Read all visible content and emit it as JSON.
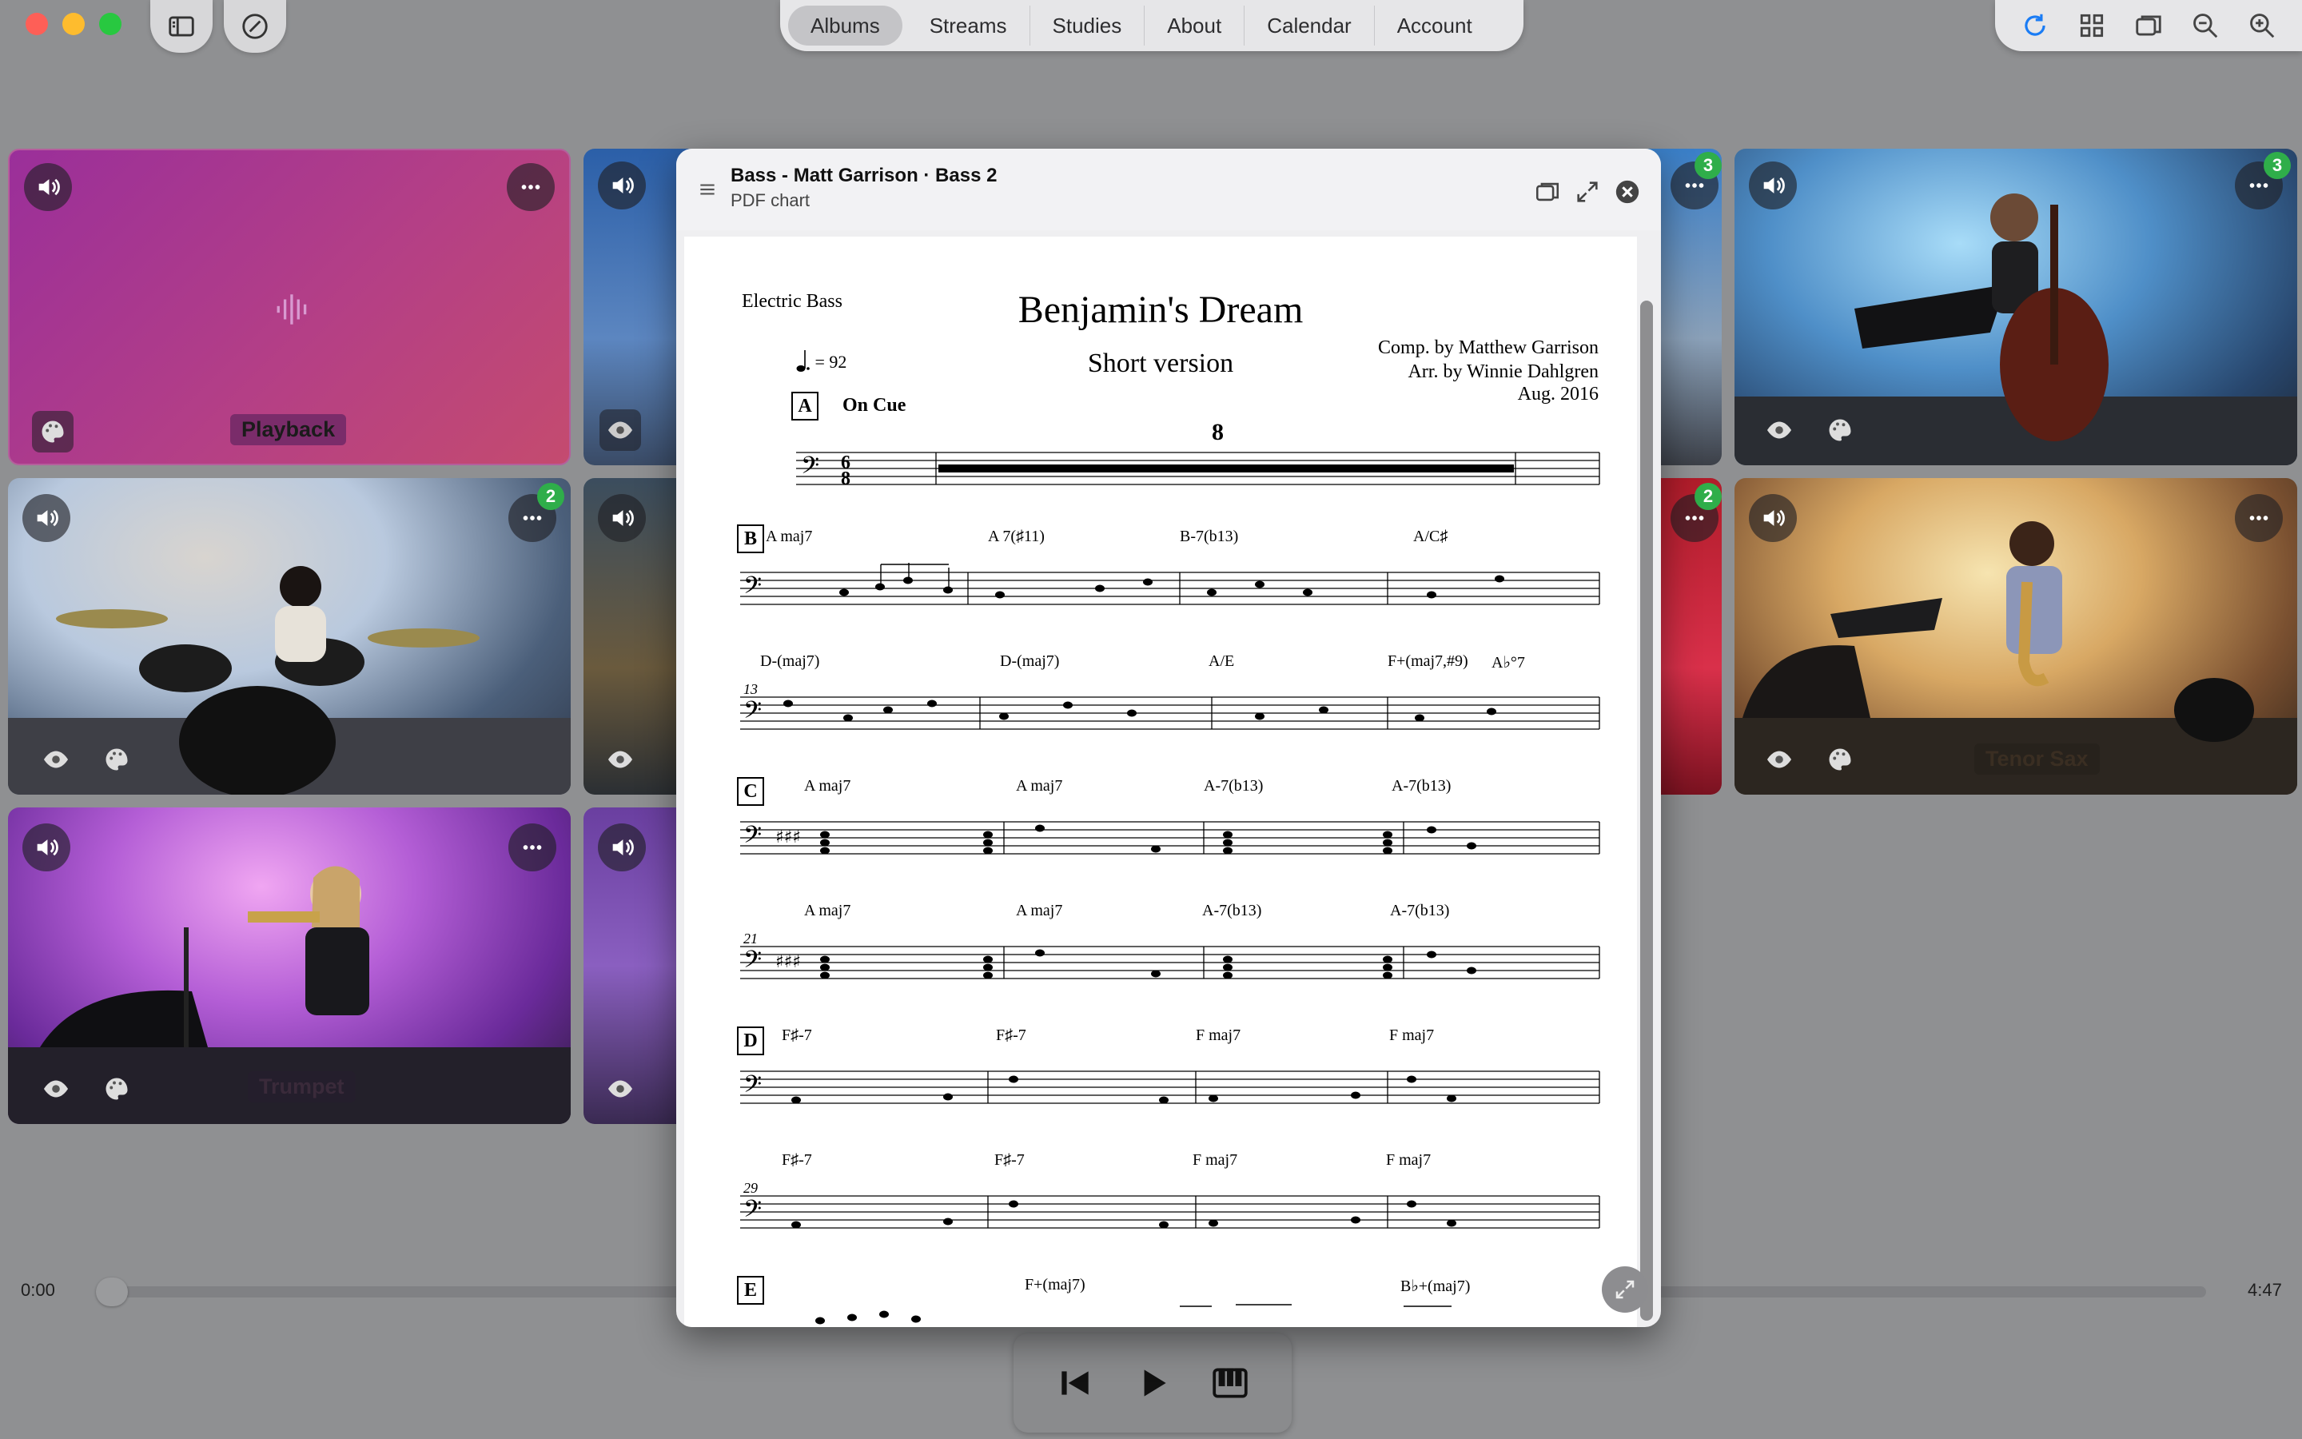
{
  "nav": {
    "tabs": [
      {
        "label": "Albums",
        "active": true
      },
      {
        "label": "Streams",
        "active": false
      },
      {
        "label": "Studies",
        "active": false
      },
      {
        "label": "About",
        "active": false
      },
      {
        "label": "Calendar",
        "active": false
      },
      {
        "label": "Account",
        "active": false
      }
    ]
  },
  "toolbar": {
    "icons": [
      "refresh-icon",
      "grid-icon",
      "windows-icon",
      "zoom-out-icon",
      "zoom-in-icon"
    ],
    "accent": "#1a7cf5"
  },
  "tiles": {
    "playback_label": "Playback",
    "trumpet_label": "Trumpet",
    "sax_label": "Tenor Sax",
    "badges": {
      "drums": "2",
      "mid_top": "3",
      "bass": "3",
      "mid_mid": "2"
    }
  },
  "transport": {
    "current_time": "0:00",
    "total_time": "4:47",
    "progress": 0
  },
  "modal": {
    "title": "Bass - Matt Garrison · Bass 2",
    "subtitle": "PDF chart"
  },
  "score": {
    "instrument": "Electric Bass",
    "title": "Benjamin's Dream",
    "subtitle": "Short version",
    "composer": "Comp. by Matthew Garrison",
    "arranger": "Arr. by Winnie Dahlgren",
    "date": "Aug. 2016",
    "tempo": "= 92",
    "cue": "On Cue",
    "multirest": "8",
    "sections": {
      "A": "A",
      "B": "B",
      "C": "C",
      "D": "D",
      "E": "E"
    },
    "measure_numbers": {
      "row3": "13",
      "row5": "21",
      "row7": "29"
    },
    "chords": {
      "row2": [
        "A maj7",
        "A 7(♯11)",
        "B-7(b13)",
        "A/C♯"
      ],
      "row3": [
        "D-(maj7)",
        "D-(maj7)",
        "A/E",
        "F+(maj7,#9)",
        "A♭°7"
      ],
      "row4": [
        "A maj7",
        "A maj7",
        "A-7(b13)",
        "A-7(b13)"
      ],
      "row5": [
        "A maj7",
        "A maj7",
        "A-7(b13)",
        "A-7(b13)"
      ],
      "row6": [
        "F♯-7",
        "F♯-7",
        "F maj7",
        "F maj7"
      ],
      "row7": [
        "F♯-7",
        "F♯-7",
        "F maj7",
        "F maj7"
      ],
      "row8": [
        "F+(maj7)",
        "B♭+(maj7)"
      ]
    }
  }
}
